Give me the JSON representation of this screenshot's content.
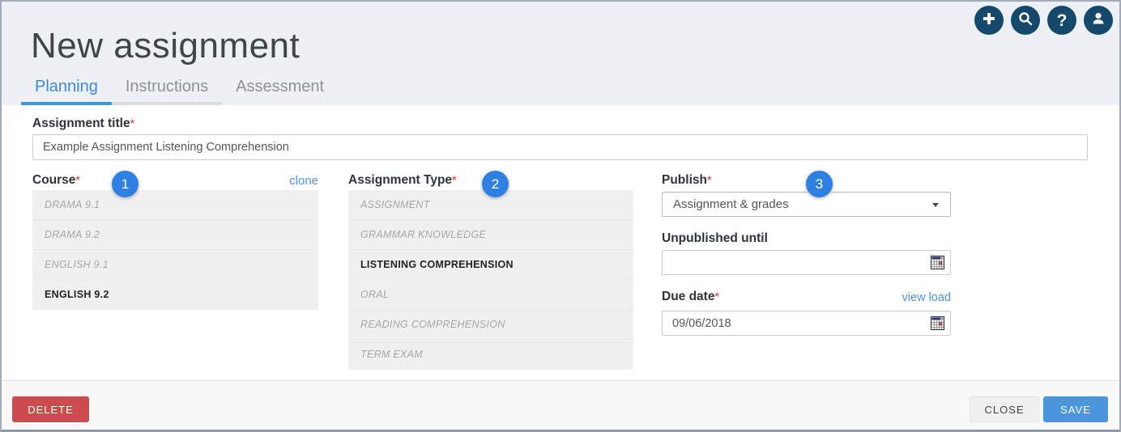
{
  "colors": {
    "accent_blue": "#3a8ad8",
    "link_blue": "#4a94e2",
    "badge_blue": "#2e81e2",
    "icon_navy": "#14496b",
    "delete_red": "#cc4b4e",
    "save_blue": "#4a96dc",
    "header_bg": "#edf0f4"
  },
  "header": {
    "title": "New assignment",
    "tabs": [
      {
        "label": "Planning"
      },
      {
        "label": "Instructions"
      },
      {
        "label": "Assessment"
      }
    ],
    "actions": [
      {
        "icon": "add-icon"
      },
      {
        "icon": "search-icon"
      },
      {
        "icon": "help-icon"
      },
      {
        "icon": "user-icon"
      }
    ]
  },
  "form": {
    "required_mark": "*",
    "title_field": {
      "label": "Assignment title",
      "value": "Example Assignment Listening Comprehension"
    },
    "course": {
      "label": "Course",
      "badge": "1",
      "clone_link": "clone",
      "options": [
        {
          "label": "DRAMA 9.1"
        },
        {
          "label": "DRAMA 9.2"
        },
        {
          "label": "ENGLISH 9.1"
        },
        {
          "label": "ENGLISH 9.2",
          "selected": true
        }
      ]
    },
    "assignment_type": {
      "label": "Assignment Type",
      "badge": "2",
      "options": [
        {
          "label": "ASSIGNMENT"
        },
        {
          "label": "GRAMMAR KNOWLEDGE"
        },
        {
          "label": "LISTENING COMPREHENSION",
          "selected": true
        },
        {
          "label": "ORAL"
        },
        {
          "label": "READING COMPREHENSION"
        },
        {
          "label": "TERM EXAM"
        }
      ]
    },
    "publish": {
      "label": "Publish",
      "badge": "3",
      "selected_option": "Assignment & grades"
    },
    "unpublished_until": {
      "label": "Unpublished until",
      "value": ""
    },
    "due_date": {
      "label": "Due date",
      "link": "view load",
      "value": "09/06/2018"
    }
  },
  "footer": {
    "delete_label": "DELETE",
    "close_label": "CLOSE",
    "save_label": "SAVE"
  }
}
